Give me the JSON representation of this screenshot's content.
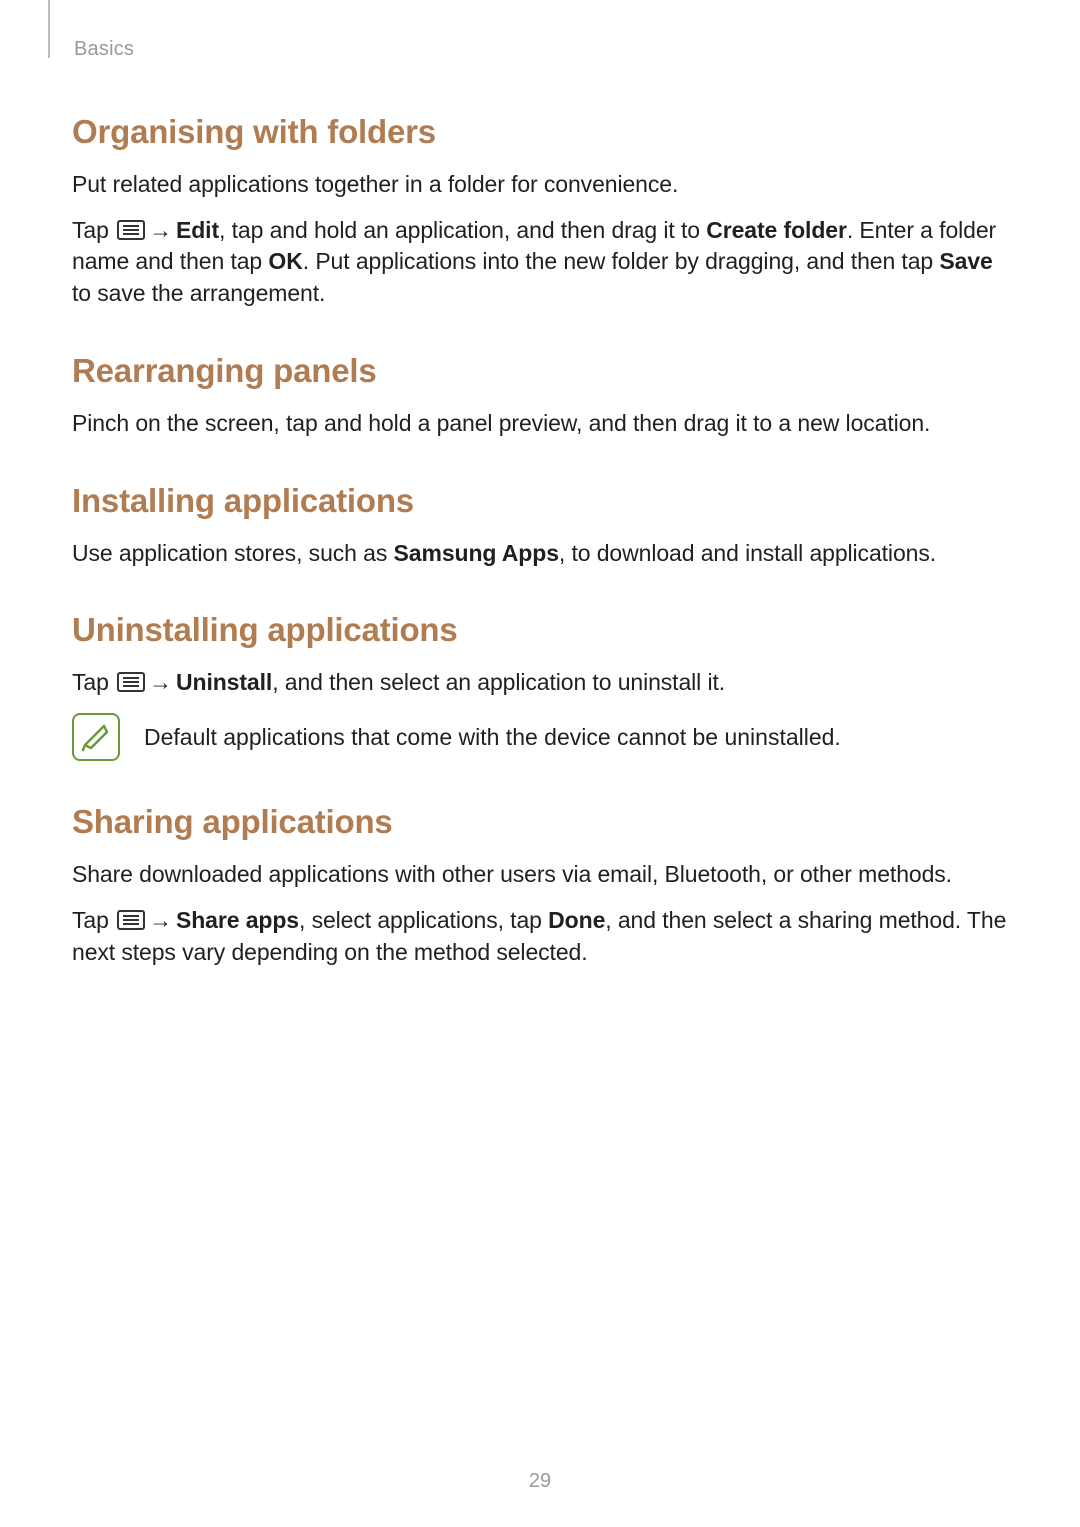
{
  "breadcrumb": "Basics",
  "page_number": "29",
  "sections": {
    "organising": {
      "heading": "Organising with folders",
      "p1": "Put related applications together in a folder for convenience.",
      "tap": "Tap ",
      "arrow": " → ",
      "edit": "Edit",
      "p2a": ", tap and hold an application, and then drag it to ",
      "create_folder": "Create folder",
      "p2b": ". Enter a folder name and then tap ",
      "ok": "OK",
      "p2c": ". Put applications into the new folder by dragging, and then tap ",
      "save": "Save",
      "p2d": " to save the arrangement."
    },
    "rearranging": {
      "heading": "Rearranging panels",
      "p1": "Pinch on the screen, tap and hold a panel preview, and then drag it to a new location."
    },
    "installing": {
      "heading": "Installing applications",
      "p1a": "Use application stores, such as ",
      "samsung_apps": "Samsung Apps",
      "p1b": ", to download and install applications."
    },
    "uninstalling": {
      "heading": "Uninstalling applications",
      "tap": "Tap ",
      "arrow": " → ",
      "uninstall": "Uninstall",
      "p1b": ", and then select an application to uninstall it.",
      "note": "Default applications that come with the device cannot be uninstalled."
    },
    "sharing": {
      "heading": "Sharing applications",
      "p1": "Share downloaded applications with other users via email, Bluetooth, or other methods.",
      "tap": "Tap ",
      "arrow": " → ",
      "share_apps": "Share apps",
      "p2a": ", select applications, tap ",
      "done": "Done",
      "p2b": ", and then select a sharing method. The next steps vary depending on the method selected."
    }
  }
}
